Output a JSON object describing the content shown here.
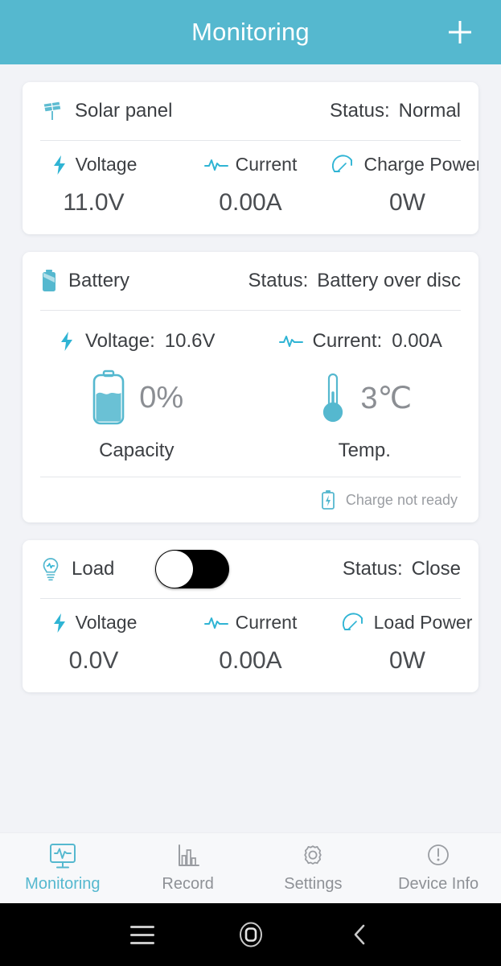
{
  "header": {
    "title": "Monitoring",
    "add_icon": "plus-icon",
    "accent_color": "#55b8cf"
  },
  "cards": {
    "solar": {
      "icon": "solar-panel-icon",
      "label": "Solar panel",
      "status_key": "Status:",
      "status_value": "Normal",
      "metrics": [
        {
          "icon": "bolt-icon",
          "name": "Voltage",
          "value": "11.0V"
        },
        {
          "icon": "pulse-icon",
          "name": "Current",
          "value": "0.00A"
        },
        {
          "icon": "gauge-icon",
          "name": "Charge Power",
          "value": "0W"
        }
      ]
    },
    "battery": {
      "icon": "battery-filled-icon",
      "label": "Battery",
      "status_key": "Status:",
      "status_value": "Battery over disc",
      "voltage_label": "Voltage:",
      "voltage_value": "10.6V",
      "current_label": "Current:",
      "current_value": "0.00A",
      "capacity_value": "0%",
      "capacity_label": "Capacity",
      "temp_value": "3℃",
      "temp_label": "Temp.",
      "footer_icon": "battery-charge-icon",
      "footer_text": "Charge not ready"
    },
    "load": {
      "icon": "bulb-icon",
      "label": "Load",
      "toggle_state": "off",
      "status_key": "Status:",
      "status_value": "Close",
      "metrics": [
        {
          "icon": "bolt-icon",
          "name": "Voltage",
          "value": "0.0V"
        },
        {
          "icon": "pulse-icon",
          "name": "Current",
          "value": "0.00A"
        },
        {
          "icon": "gauge-icon",
          "name": "Load Power",
          "value": "0W"
        }
      ]
    }
  },
  "tabbar": {
    "items": [
      {
        "icon": "monitor-pulse-icon",
        "label": "Monitoring",
        "active": true
      },
      {
        "icon": "bar-chart-icon",
        "label": "Record",
        "active": false
      },
      {
        "icon": "gear-icon",
        "label": "Settings",
        "active": false
      },
      {
        "icon": "info-circle-icon",
        "label": "Device Info",
        "active": false
      }
    ]
  },
  "sysnav": {
    "recents_icon": "menu-icon",
    "home_icon": "home-square-icon",
    "back_icon": "chevron-left-icon"
  }
}
